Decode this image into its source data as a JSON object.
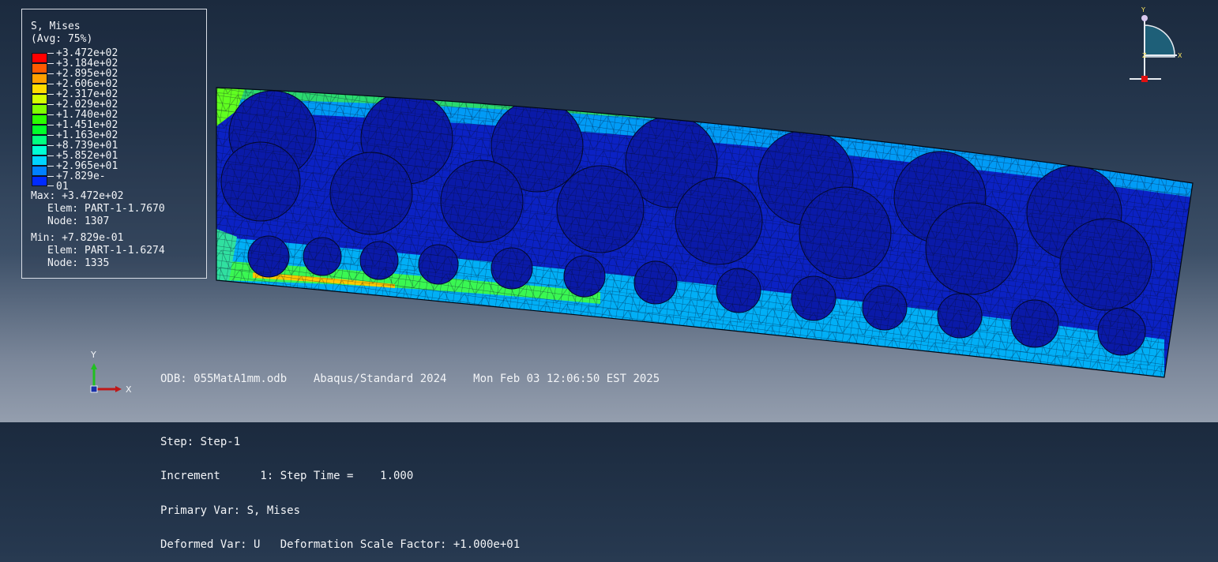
{
  "legend": {
    "title": "S, Mises",
    "subtitle": "(Avg: 75%)",
    "entries": [
      {
        "label": "+3.472e+02",
        "color": "#ff0000"
      },
      {
        "label": "+3.184e+02",
        "color": "#ff5a00"
      },
      {
        "label": "+2.895e+02",
        "color": "#ffa000"
      },
      {
        "label": "+2.606e+02",
        "color": "#ffdc00"
      },
      {
        "label": "+2.317e+02",
        "color": "#d4ff00"
      },
      {
        "label": "+2.029e+02",
        "color": "#80ff00"
      },
      {
        "label": "+1.740e+02",
        "color": "#2bff00"
      },
      {
        "label": "+1.451e+02",
        "color": "#00ff2a"
      },
      {
        "label": "+1.163e+02",
        "color": "#00ff80"
      },
      {
        "label": "+8.739e+01",
        "color": "#00ffd4"
      },
      {
        "label": "+5.852e+01",
        "color": "#00d4ff"
      },
      {
        "label": "+2.965e+01",
        "color": "#0080ff"
      },
      {
        "label": "+7.829e-01",
        "color": "#002bff"
      }
    ],
    "max_line": "Max: +3.472e+02",
    "max_elem": "Elem: PART-1-1.7670",
    "max_node": "Node: 1307",
    "min_line": "Min: +7.829e-01",
    "min_elem": "Elem: PART-1-1.6274",
    "min_node": "Node: 1335"
  },
  "triad_top": {
    "y": "Y",
    "x": "X",
    "z": "Z"
  },
  "triad_bottom": {
    "y": "Y",
    "x": "X"
  },
  "info": {
    "line1": "ODB: 055MatA1mm.odb    Abaqus/Standard 2024    Mon Feb 03 12:06:50 EST 2025",
    "line2": "Step: Step-1",
    "line3": "Increment      1: Step Time =    1.000",
    "line4": "Primary Var: S, Mises",
    "line5": "Deformed Var: U   Deformation Scale Factor: +1.000e+01"
  },
  "colors": {
    "mesh_base": "#0a1fb8",
    "mesh_line": "#050a26",
    "high_stress": "#ff3a00",
    "mid_stress": "#7dff00",
    "low_stress": "#00c8ff"
  }
}
